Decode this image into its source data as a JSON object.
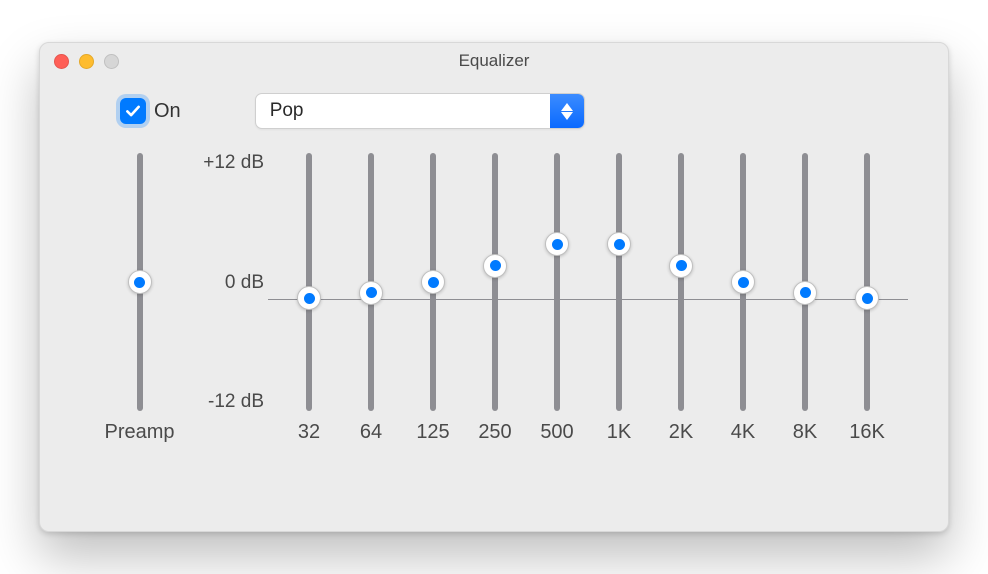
{
  "window": {
    "title": "Equalizer"
  },
  "toggle": {
    "checked": true,
    "label": "On"
  },
  "preset": {
    "selected": "Pop"
  },
  "scale": {
    "max_label": "+12 dB",
    "mid_label": "0 dB",
    "min_label": "-12 dB",
    "min": -12,
    "max": 12
  },
  "preamp": {
    "label": "Preamp",
    "value_db": 0
  },
  "bands": [
    {
      "freq_label": "32",
      "value_db": -1.5
    },
    {
      "freq_label": "64",
      "value_db": -1.0
    },
    {
      "freq_label": "125",
      "value_db": 0.0
    },
    {
      "freq_label": "250",
      "value_db": 1.5
    },
    {
      "freq_label": "500",
      "value_db": 3.5
    },
    {
      "freq_label": "1K",
      "value_db": 3.5
    },
    {
      "freq_label": "2K",
      "value_db": 1.5
    },
    {
      "freq_label": "4K",
      "value_db": 0.0
    },
    {
      "freq_label": "8K",
      "value_db": -1.0
    },
    {
      "freq_label": "16K",
      "value_db": -1.5
    }
  ],
  "chart_data": {
    "type": "bar",
    "title": "Equalizer",
    "categories": [
      "32",
      "64",
      "125",
      "250",
      "500",
      "1K",
      "2K",
      "4K",
      "8K",
      "16K"
    ],
    "values": [
      -1.5,
      -1.0,
      0.0,
      1.5,
      3.5,
      3.5,
      1.5,
      0.0,
      -1.0,
      -1.5
    ],
    "ylabel": "dB",
    "ylim": [
      -12,
      12
    ]
  }
}
